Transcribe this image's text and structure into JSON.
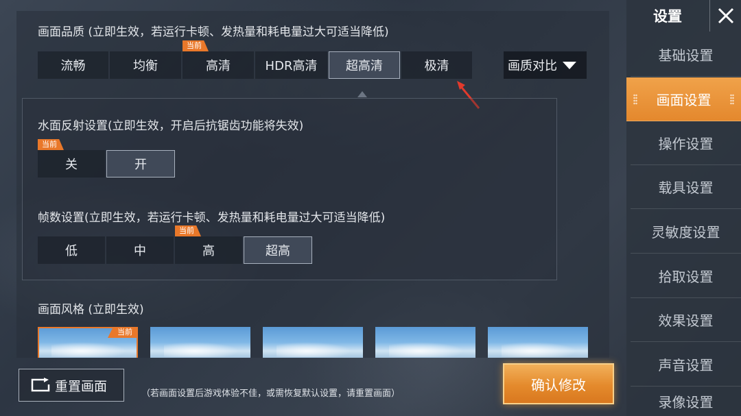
{
  "quality": {
    "label": "画面品质 (立即生效，若运行卡顿、发热量和耗电量过大可适当降低)",
    "options": [
      "流畅",
      "均衡",
      "高清",
      "HDR高清",
      "超高清",
      "极清"
    ],
    "current_badge": "当前",
    "current_index": 2,
    "selected_index": 4,
    "compare_label": "画质对比"
  },
  "water": {
    "label": "水面反射设置(立即生效，开启后抗锯齿功能将失效)",
    "options": [
      "关",
      "开"
    ],
    "current_badge": "当前",
    "current_index": 0,
    "selected_index": 1
  },
  "fps": {
    "label": "帧数设置(立即生效，若运行卡顿、发热量和耗电量过大可适当降低)",
    "options": [
      "低",
      "中",
      "高",
      "超高"
    ],
    "current_badge": "当前",
    "current_index": 2,
    "selected_index": 3
  },
  "style": {
    "label": "画面风格 (立即生效)",
    "current_badge": "当前",
    "current_index": 0,
    "count": 5
  },
  "bottom": {
    "reset_label": "重置画面",
    "hint": "（若画面设置后游戏体验不佳，或需恢复默认设置，请重置画面）",
    "confirm_label": "确认修改"
  },
  "sidebar": {
    "title": "设置",
    "items": [
      "基础设置",
      "画面设置",
      "操作设置",
      "载具设置",
      "灵敏度设置",
      "拾取设置",
      "效果设置",
      "声音设置",
      "录像设置"
    ],
    "active_index": 1
  },
  "colors": {
    "accent_orange": "#e9782a",
    "annotation_red": "#e23a2c"
  }
}
